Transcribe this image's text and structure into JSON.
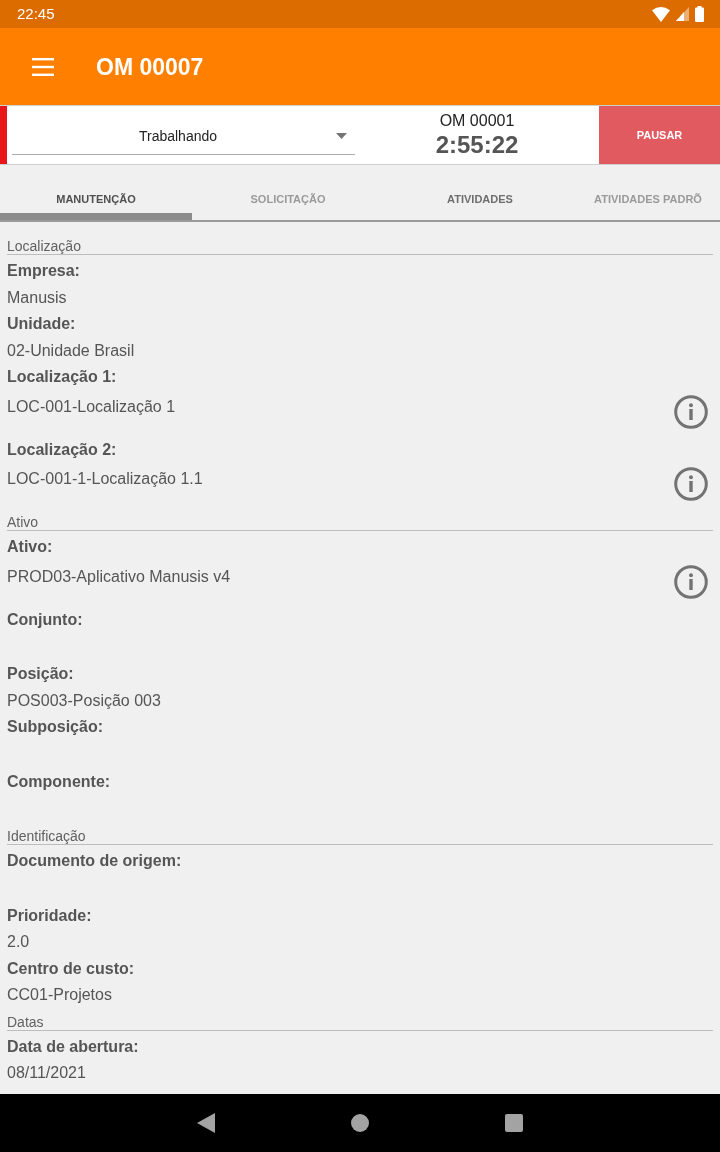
{
  "status_bar": {
    "time": "22:45"
  },
  "app_bar": {
    "title": "OM 00007"
  },
  "work_bar": {
    "status_select": {
      "value": "Trabalhando"
    },
    "order": "OM 00001",
    "timer": "2:55:22",
    "pause_button": "PAUSAR"
  },
  "tabs": [
    {
      "label": "MANUTENÇÃO",
      "selected": true,
      "disabled": false
    },
    {
      "label": "SOLICITAÇÃO",
      "selected": false,
      "disabled": true
    },
    {
      "label": "ATIVIDADES",
      "selected": false,
      "disabled": false
    },
    {
      "label": "ATIVIDADES PADRÕ",
      "selected": false,
      "disabled": true
    }
  ],
  "sections": [
    {
      "title": "Localização",
      "fields": [
        {
          "label": "Empresa:",
          "value": "Manusis",
          "info": false
        },
        {
          "label": "Unidade:",
          "value": "02-Unidade Brasil",
          "info": false
        },
        {
          "label": "Localização 1:",
          "value": "LOC-001-Localização 1",
          "info": true
        },
        {
          "label": "Localização 2:",
          "value": "LOC-001-1-Localização 1.1",
          "info": true
        }
      ]
    },
    {
      "title": "Ativo",
      "fields": [
        {
          "label": "Ativo:",
          "value": "PROD03-Aplicativo Manusis v4",
          "info": true
        },
        {
          "label": "Conjunto:",
          "info": false
        },
        {
          "label": "Posição:",
          "value": "POS003-Posição 003",
          "info": false
        },
        {
          "label": "Subposição:",
          "info": false
        },
        {
          "label": "Componente:",
          "info": false
        }
      ]
    },
    {
      "title": "Identificação",
      "fields": [
        {
          "label": "Documento de origem:",
          "info": false
        },
        {
          "label": "Prioridade:",
          "value": "2.0",
          "info": false
        },
        {
          "label": "Centro de custo:",
          "value": "CC01-Projetos",
          "info": false
        }
      ]
    },
    {
      "title": "Datas",
      "fields": [
        {
          "label": "Data de abertura:",
          "value": "08/11/2021",
          "info": false
        }
      ]
    }
  ]
}
